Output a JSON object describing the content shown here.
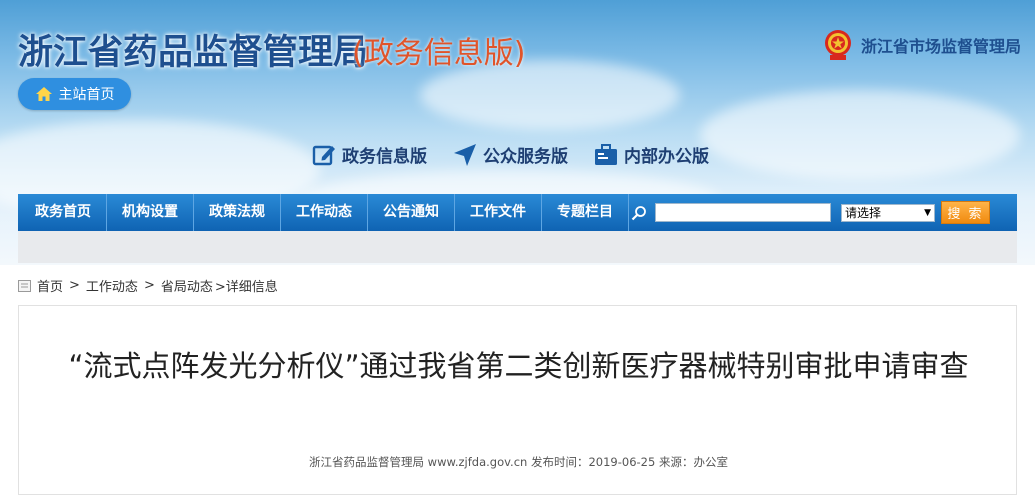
{
  "header": {
    "site_title": "浙江省药品监督管理局",
    "site_subtitle": "(政务信息版)",
    "home_button": "主站首页",
    "agency_name": "浙江省市场监督管理局",
    "versions": [
      {
        "label": "政务信息版",
        "icon": "edit-icon"
      },
      {
        "label": "公众服务版",
        "icon": "navigation-arrow-icon"
      },
      {
        "label": "内部办公版",
        "icon": "briefcase-icon"
      }
    ]
  },
  "nav": {
    "items": [
      "政务首页",
      "机构设置",
      "政策法规",
      "工作动态",
      "公告通知",
      "工作文件",
      "专题栏目"
    ],
    "search_value": "",
    "select_value": "请选择",
    "search_button": "搜 索"
  },
  "breadcrumb": {
    "home": "首页",
    "sep1": ">",
    "level1": "工作动态",
    "sep2": ">",
    "level2": "省局动态",
    "current": ">详细信息"
  },
  "article": {
    "title": "“流式点阵发光分析仪”通过我省第二类创新医疗器械特别审批申请审查",
    "meta": "浙江省药品监督管理局 www.zjfda.gov.cn 发布时间：2019-06-25 来源：办公室"
  },
  "colors": {
    "title_blue": "#1e4f8f",
    "subtitle_orange": "#e0542a",
    "nav_blue": "#1473c4",
    "search_orange": "#f39a1c"
  }
}
